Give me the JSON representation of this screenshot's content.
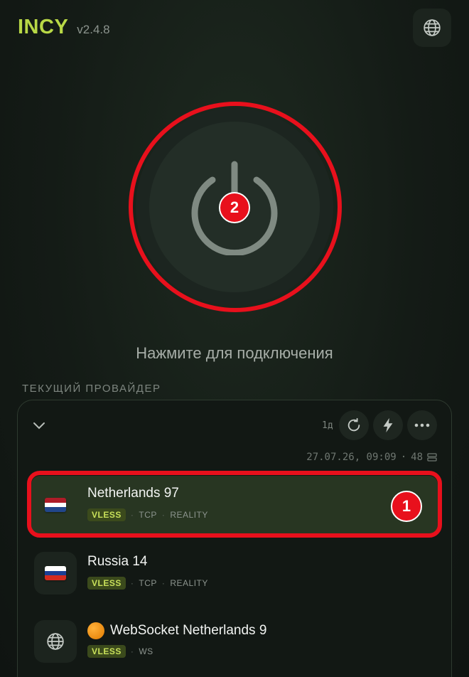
{
  "header": {
    "brand": "INCY",
    "version": "v2.4.8",
    "language_icon": "globe-icon"
  },
  "power": {
    "icon": "power-icon",
    "badge": "2",
    "hint": "Нажмите для подключения"
  },
  "provider": {
    "section_label": "ТЕКУЩИЙ ПРОВАЙДЕР",
    "age": "1д",
    "updated": "27.07.26, 09:09",
    "dot": "·",
    "server_count": "48",
    "actions": [
      "refresh-icon",
      "bolt-icon",
      "more-icon"
    ]
  },
  "servers": [
    {
      "name": "Netherlands 97",
      "flag": "netherlands-flag",
      "protocol": "VLESS",
      "transport": "TCP",
      "security": "REALITY",
      "selected": true,
      "badge": "1"
    },
    {
      "name": "Russia 14",
      "flag": "russia-flag",
      "protocol": "VLESS",
      "transport": "TCP",
      "security": "REALITY",
      "selected": false
    },
    {
      "name": "WebSocket Netherlands 9",
      "flag": "globe-icon",
      "emoji": "orange-circle",
      "protocol": "VLESS",
      "transport": "WS",
      "selected": false
    }
  ],
  "colors": {
    "accent": "#b8d846",
    "highlight": "#e8101c",
    "background": "#141b16",
    "tag_bg": "#3b4a1c"
  }
}
